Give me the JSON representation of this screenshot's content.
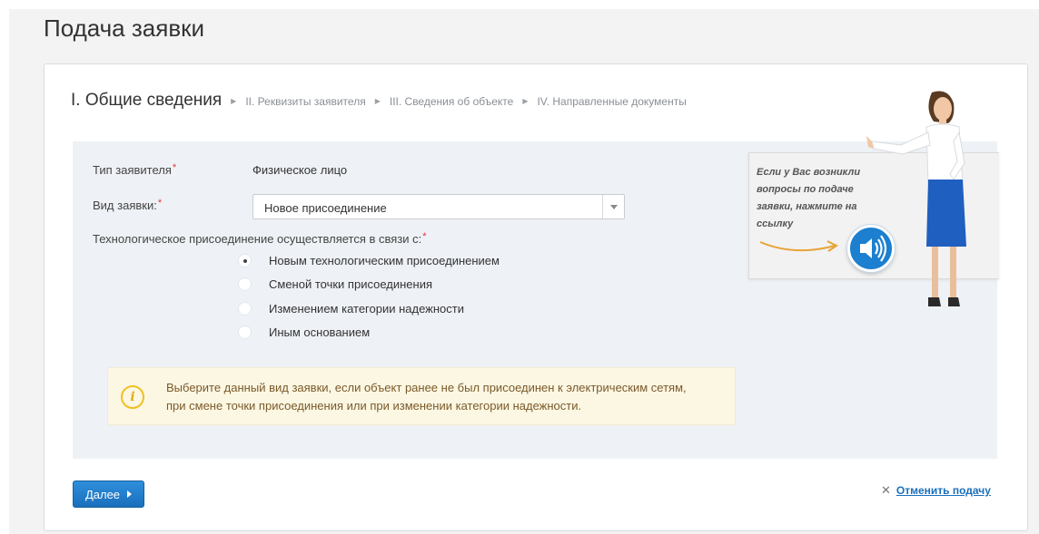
{
  "page": {
    "title": "Подача заявки"
  },
  "steps": [
    {
      "label": "I. Общие сведения",
      "active": true
    },
    {
      "label": "II. Реквизиты заявителя",
      "active": false
    },
    {
      "label": "III. Сведения об объекте",
      "active": false
    },
    {
      "label": "IV. Направленные документы",
      "active": false
    }
  ],
  "form": {
    "applicant_type_label": "Тип заявителя",
    "applicant_type_value": "Физическое лицо",
    "request_type_label": "Вид заявки:",
    "request_type_value": "Новое присоединение",
    "reason_label": "Технологическое присоединение осуществляется в связи с:",
    "required_mark": "*",
    "reasons": [
      {
        "label": "Новым технологическим присоединением",
        "checked": true
      },
      {
        "label": "Сменой точки присоединения",
        "checked": false
      },
      {
        "label": "Изменением категории надежности",
        "checked": false
      },
      {
        "label": "Иным основанием",
        "checked": false
      }
    ]
  },
  "info": {
    "icon": "info-icon",
    "glyph": "i",
    "line1": "Выберите данный вид заявки, если объект ранее не был присоединен к электрическим сетям,",
    "line2": "при смене точки присоединения или при изменении категории надежности."
  },
  "help": {
    "line1": "Если у Вас возникли",
    "line2": "вопросы по подаче",
    "line3": "заявки, нажмите на",
    "line4": "ссылку",
    "icon": "speaker-icon"
  },
  "actions": {
    "next_label": "Далее",
    "cancel_label": "Отменить подачу",
    "cancel_icon": "close-icon"
  },
  "colors": {
    "accent": "#1a6fbc",
    "required": "#e2363a",
    "info_bg": "#fcf7e3",
    "panel_bg": "#eef1f5"
  }
}
